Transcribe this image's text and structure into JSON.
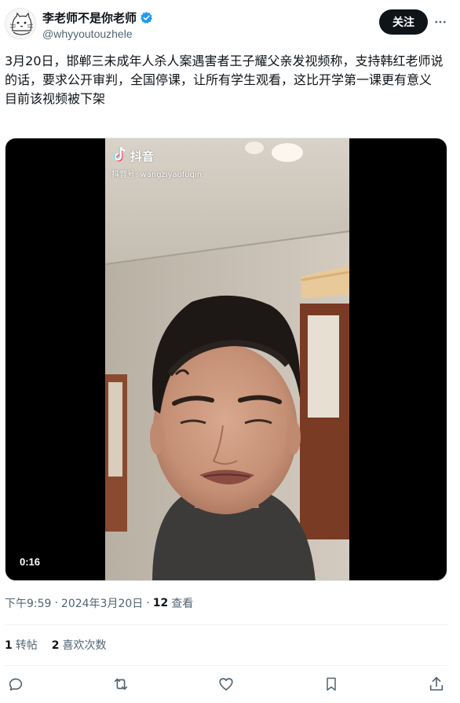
{
  "author": {
    "display_name": "李老师不是你老师",
    "handle": "@whyyoutouzhele",
    "verified": true
  },
  "header": {
    "follow_label": "关注"
  },
  "tweet": {
    "text": "3月20日，邯郸三未成年人杀人案遇害者王子耀父亲发视频称，支持韩红老师说的话，要求公开审判，全国停课，让所有学生观看，这比开学第一课更有意义\n目前该视频被下架"
  },
  "media": {
    "duration": "0:16",
    "watermark_app": "抖音",
    "watermark_id": "抖音号: wangziyaofuqin"
  },
  "meta": {
    "time": "下午9:59",
    "date": "2024年3月20日",
    "separator": "·",
    "views_count": "12",
    "views_label": "查看"
  },
  "stats": {
    "retweets_count": "1",
    "retweets_label": "转帖",
    "likes_count": "2",
    "likes_label": "喜欢次数"
  },
  "colors": {
    "text": "#0f1419",
    "muted": "#536471",
    "verified": "#1d9bf0",
    "button_bg": "#0f1419"
  },
  "icons": [
    "verified-badge-icon",
    "more-icon",
    "reply-icon",
    "retweet-icon",
    "like-icon",
    "bookmark-icon",
    "share-icon",
    "tiktok-logo-icon"
  ]
}
